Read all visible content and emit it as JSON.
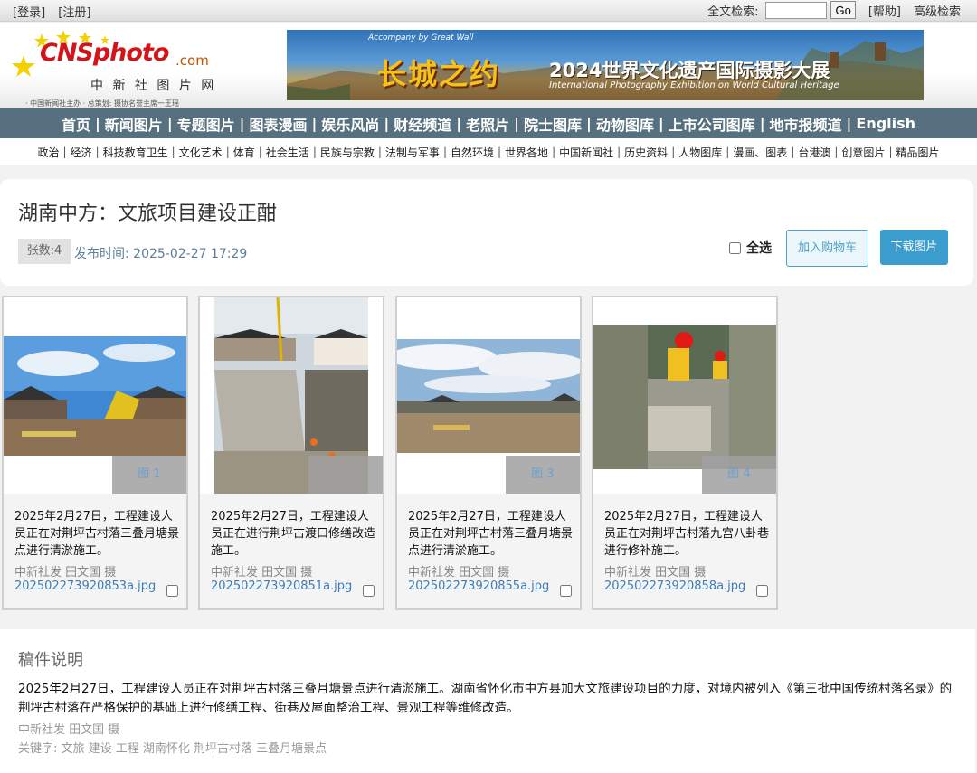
{
  "topbar": {
    "login": "[登录]",
    "register": "[注册]",
    "search_label": "全文检索:",
    "search_value": "",
    "go": "Go",
    "help": "[帮助]",
    "advanced": "高级检索"
  },
  "logo": {
    "brand": "CNSphoto",
    "dotcom": ".com",
    "cn_name": "中 新 社 图 片 网",
    "tagline": "· 中国新闻社主办 · 总策划: 摄协名誉主席一王瑶"
  },
  "banner": {
    "tag": "Accompany by Great Wall",
    "title": "长城之约",
    "subtitle": "2024世界文化遗产国际摄影大展",
    "english": "International Photography Exhibition on World Cultural Heritage"
  },
  "main_nav": [
    "首页",
    "新闻图片",
    "专题图片",
    "图表漫画",
    "娱乐风尚",
    "财经频道",
    "老照片",
    "院士图库",
    "动物图库",
    "上市公司图库",
    "地市报频道",
    "English"
  ],
  "sub_nav": [
    "政治",
    "经济",
    "科技教育卫生",
    "文化艺术",
    "体育",
    "社会生活",
    "民族与宗教",
    "法制与军事",
    "自然环境",
    "世界各地",
    "中国新闻社",
    "历史资料",
    "人物图库",
    "漫画、图表",
    "台港澳",
    "创意图片",
    "精品图片"
  ],
  "article": {
    "title": "湖南中方：文旅项目建设正酣",
    "count": "张数:4",
    "pub_time": "发布时间: 2025-02-27 17:29",
    "select_all": "全选",
    "add_cart": "加入购物车",
    "download": "下载图片"
  },
  "photos": [
    {
      "tag": "图 1",
      "caption": "2025年2月27日，工程建设人员正在对荆坪古村落三叠月塘景点进行清淤施工。",
      "credit": "中新社发 田文国 摄",
      "file": "202502273920853a.jpg"
    },
    {
      "tag": "",
      "caption": "2025年2月27日，工程建设人员正在进行荆坪古渡口修缮改造施工。",
      "credit": "中新社发 田文国 摄",
      "file": "202502273920851a.jpg"
    },
    {
      "tag": "图 3",
      "caption": "2025年2月27日，工程建设人员正在对荆坪古村落三叠月塘景点进行清淤施工。",
      "credit": "中新社发 田文国 摄",
      "file": "202502273920855a.jpg"
    },
    {
      "tag": "图 4",
      "caption": "2025年2月27日，工程建设人员正在对荆坪古村落九宫八卦巷进行修补施工。",
      "credit": "中新社发 田文国 摄",
      "file": "202502273920858a.jpg"
    }
  ],
  "description": {
    "heading": "稿件说明",
    "body": "2025年2月27日，工程建设人员正在对荆坪古村落三叠月塘景点进行清淤施工。湖南省怀化市中方县加大文旅建设项目的力度，对境内被列入《第三批中国传统村落名录》的荆坪古村落在严格保护的基础上进行修缮工程、街巷及屋面整治工程、景观工程等维修改造。",
    "credit": "中新社发 田文国 摄",
    "keywords": "关键字: 文旅 建设 工程 湖南怀化 荆坪古村落 三叠月塘景点"
  }
}
